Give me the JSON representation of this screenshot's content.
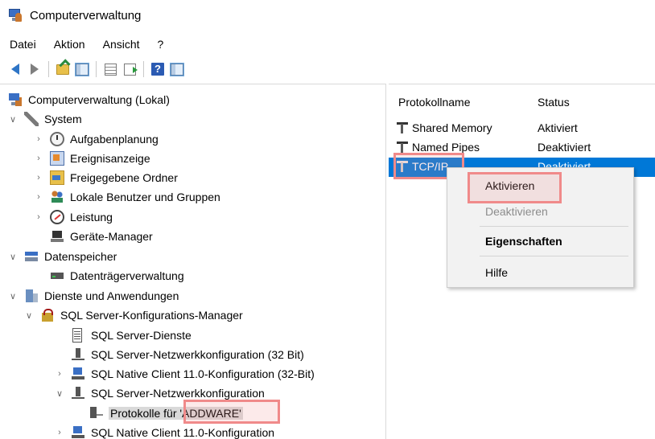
{
  "window": {
    "title": "Computerverwaltung"
  },
  "menubar": {
    "items": [
      "Datei",
      "Aktion",
      "Ansicht",
      "?"
    ]
  },
  "toolbar": {
    "icons": [
      "back-arrow-icon",
      "forward-arrow-icon",
      "up-folder-icon",
      "show-hide-tree-icon",
      "properties-list-icon",
      "export-list-icon",
      "help-icon",
      "show-hide-action-pane-icon"
    ]
  },
  "tree": {
    "root": "Computerverwaltung (Lokal)",
    "system": "System",
    "aufgabenplanung": "Aufgabenplanung",
    "ereignisanzeige": "Ereignisanzeige",
    "freigegebene_ordner": "Freigegebene Ordner",
    "lokale_benutzer": "Lokale Benutzer und Gruppen",
    "leistung": "Leistung",
    "geraete_manager": "Geräte-Manager",
    "datenspeicher": "Datenspeicher",
    "datentraegerverwaltung": "Datenträgerverwaltung",
    "dienste": "Dienste und Anwendungen",
    "sql_manager": "SQL Server-Konfigurations-Manager",
    "sql_dienste": "SQL Server-Dienste",
    "sql_netz_32": "SQL Server-Netzwerkkonfiguration (32 Bit)",
    "native_client_32": "SQL Native Client 11.0-Konfiguration (32-Bit)",
    "sql_netz": "SQL Server-Netzwerkkonfiguration",
    "protokolle": "Protokolle für 'ADDWARE'",
    "native_client": "SQL Native Client 11.0-Konfiguration"
  },
  "list": {
    "columns": {
      "name": "Protokollname",
      "status": "Status"
    },
    "rows": [
      {
        "name": "Shared Memory",
        "status": "Aktiviert"
      },
      {
        "name": "Named Pipes",
        "status": "Deaktiviert"
      },
      {
        "name": "TCP/IP",
        "status": "Deaktiviert"
      }
    ]
  },
  "context_menu": {
    "activate": "Aktivieren",
    "deactivate": "Deaktivieren",
    "properties": "Eigenschaften",
    "help": "Hilfe"
  },
  "colors": {
    "selection": "#0078d7",
    "highlight_box": "#f08a8a",
    "menu_background": "#f2f2f2"
  }
}
